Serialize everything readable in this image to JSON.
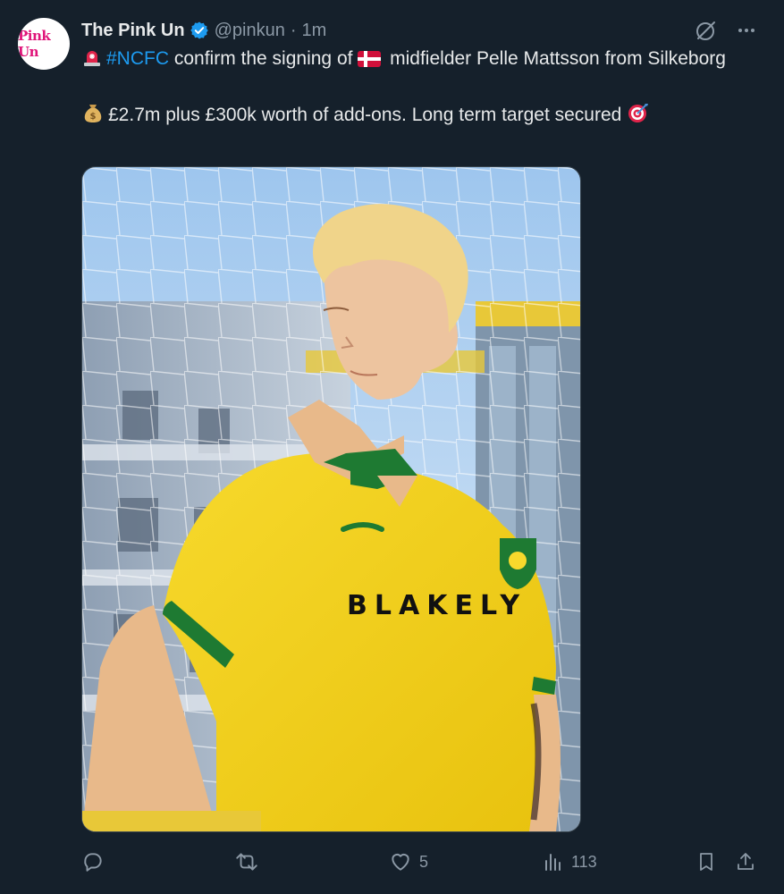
{
  "tweet": {
    "avatar_text": "Pink Un",
    "display_name": "The Pink Un",
    "handle": "@pinkun",
    "separator": "·",
    "time": "1m",
    "line1_hashtag": "#NCFC",
    "line1_before_flag": " confirm the signing of ",
    "line1_after_flag": " midfielder Pelle Mattsson from Silkeborg",
    "line2": "£2.7m plus £300k worth of add-ons. Long term target secured",
    "shirt_sponsor": "BLAKELY"
  },
  "actions": {
    "reply_count": "",
    "retweet_count": "",
    "like_count": "5",
    "views_count": "113"
  },
  "icons": {
    "verified": "verified-badge-icon",
    "grok": "grok-icon",
    "more": "more-icon",
    "siren": "siren-emoji-icon",
    "flag": "denmark-flag-icon",
    "money": "money-bag-emoji-icon",
    "target": "target-emoji-icon",
    "reply": "reply-icon",
    "retweet": "retweet-icon",
    "like": "heart-icon",
    "views": "views-icon",
    "bookmark": "bookmark-icon",
    "share": "share-icon"
  },
  "colors": {
    "background": "#15202b",
    "text": "#e7e9ea",
    "muted": "#8b98a5",
    "link": "#1d9bf0",
    "brand_pink": "#e0157a",
    "shirt_yellow": "#f2cf1a",
    "shirt_green": "#1e7a32"
  }
}
